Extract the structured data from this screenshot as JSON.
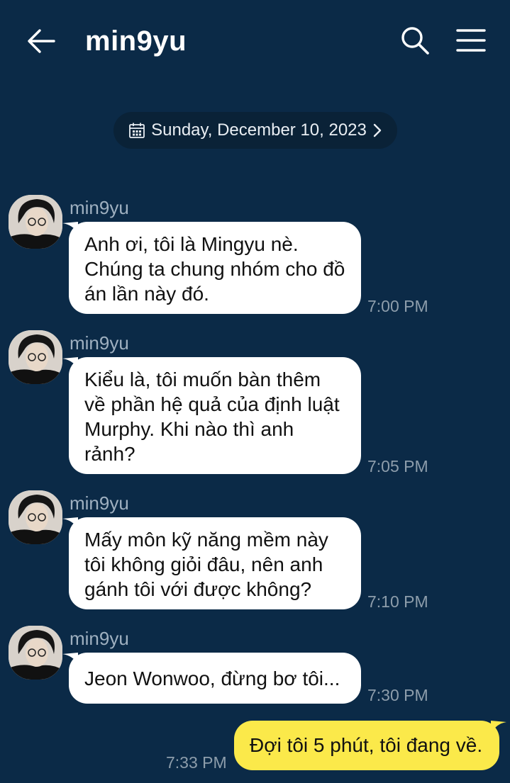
{
  "header": {
    "title": "min9yu",
    "icons": {
      "back": "arrow-left-icon",
      "search": "search-icon",
      "menu": "hamburger-menu-icon"
    }
  },
  "date_divider": {
    "label": "Sunday, December 10, 2023",
    "icon": "calendar-icon"
  },
  "messages": [
    {
      "sender": "min9yu",
      "text": "Anh ơi, tôi là Mingyu nè. Chúng ta chung nhóm cho đồ án lần này đó.",
      "time": "7:00 PM"
    },
    {
      "sender": "min9yu",
      "text": "Kiểu là, tôi muốn bàn thêm về phần hệ quả của định luật Murphy. Khi nào thì anh rảnh?",
      "time": "7:05 PM"
    },
    {
      "sender": "min9yu",
      "text": "Mấy môn kỹ năng mềm này tôi không giỏi đâu, nên anh gánh tôi với được không?",
      "time": "7:10 PM"
    },
    {
      "sender": "min9yu",
      "text": "Jeon Wonwoo, đừng bơ tôi...",
      "time": "7:30 PM"
    }
  ],
  "my_message": {
    "text": "Đợi tôi 5 phút, tôi đang về.",
    "time": "7:33 PM"
  },
  "colors": {
    "background": "#0b2a47",
    "incoming_bubble": "#ffffff",
    "outgoing_bubble": "#fbe94a"
  }
}
